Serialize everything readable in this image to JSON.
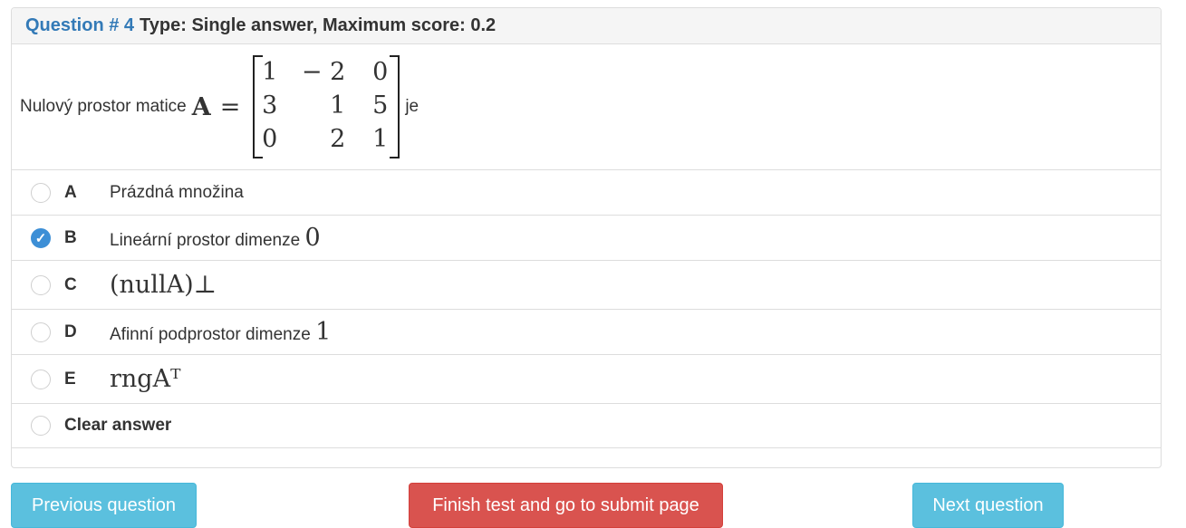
{
  "question": {
    "number_label": "Question # 4",
    "type_label": "Type: Single answer, Maximum score: 0.2",
    "text_before": "Nulový prostor matice",
    "matrix_symbol": "A",
    "equals": "=",
    "matrix": [
      [
        "1",
        "− 2",
        "0"
      ],
      [
        "3",
        "1",
        "5"
      ],
      [
        "0",
        "2",
        "1"
      ]
    ],
    "text_after": "je"
  },
  "options": [
    {
      "letter": "A",
      "text": "Prázdná množina",
      "math": "",
      "checked": false
    },
    {
      "letter": "B",
      "text": "Lineární prostor dimenze",
      "math": "0",
      "checked": true
    },
    {
      "letter": "C",
      "text": "",
      "math": "(nullA)⊥",
      "checked": false
    },
    {
      "letter": "D",
      "text": "Afinní podprostor dimenze",
      "math": "1",
      "checked": false
    },
    {
      "letter": "E",
      "text": "",
      "math": "rngAᵀ",
      "checked": false
    }
  ],
  "clear_label": "Clear answer",
  "buttons": {
    "previous": "Previous question",
    "finish": "Finish test and go to submit page",
    "next": "Next question"
  },
  "colors": {
    "heading_link": "#337ab7",
    "info_button": "#5bc0de",
    "danger_button": "#d9534f",
    "radio_checked": "#3d8fd6"
  }
}
